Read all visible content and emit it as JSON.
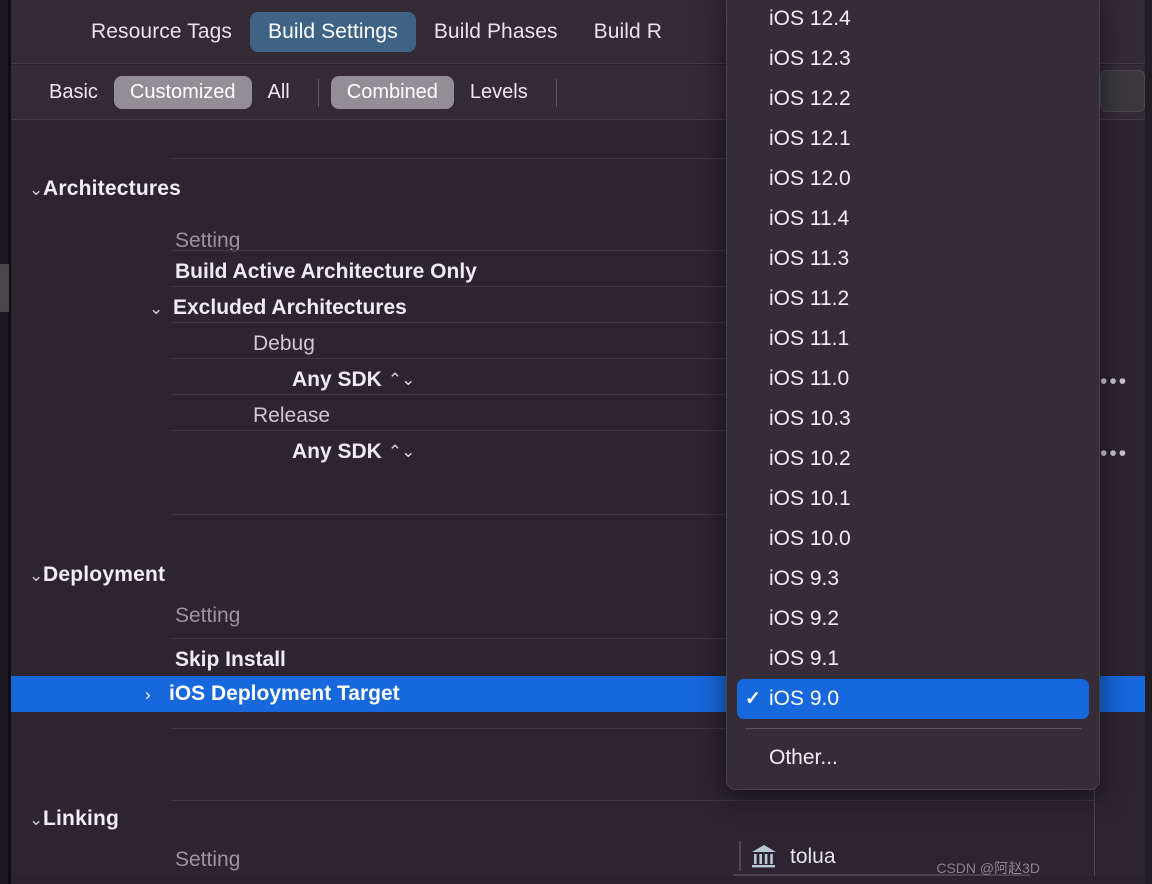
{
  "window": {
    "background_color": "#2a222c",
    "accent_blue": "#1668dc",
    "tab_active_color": "#3f6384"
  },
  "tabbar": {
    "tabs": [
      {
        "label": "Resource Tags",
        "active": false
      },
      {
        "label": "Build Settings",
        "active": true
      },
      {
        "label": "Build Phases",
        "active": false
      },
      {
        "label": "Build R",
        "active": false
      }
    ]
  },
  "filterbar": {
    "segments": [
      {
        "label": "Basic",
        "on": false
      },
      {
        "label": "Customized",
        "on": true
      },
      {
        "label": "All",
        "on": false
      },
      {
        "label": "Combined",
        "on": true
      },
      {
        "label": "Levels",
        "on": false
      }
    ],
    "search_placeholder": ""
  },
  "settings": {
    "column_header": "Setting",
    "groups": [
      {
        "title": "Architectures",
        "expanded": true,
        "rows": [
          {
            "kind": "header",
            "label": "Setting"
          },
          {
            "kind": "setting",
            "label": "Build Active Architecture Only",
            "indent": 1,
            "disclosure": false
          },
          {
            "kind": "setting",
            "label": "Excluded Architectures",
            "indent": 1,
            "disclosure": true,
            "disclosure_state": "expanded"
          },
          {
            "kind": "sub",
            "label": "Debug",
            "indent": 2
          },
          {
            "kind": "value",
            "label": "Any SDK",
            "indent": 3,
            "stepper": true,
            "more": true
          },
          {
            "kind": "sub",
            "label": "Release",
            "indent": 2
          },
          {
            "kind": "value",
            "label": "Any SDK",
            "indent": 3,
            "stepper": true,
            "more": true
          }
        ]
      },
      {
        "title": "Deployment",
        "expanded": true,
        "rows": [
          {
            "kind": "header",
            "label": "Setting"
          },
          {
            "kind": "setting",
            "label": "Skip Install",
            "indent": 1,
            "disclosure": false
          },
          {
            "kind": "setting",
            "label": "iOS Deployment Target",
            "indent": 1,
            "disclosure": true,
            "disclosure_state": "collapsed",
            "selected": true
          }
        ]
      },
      {
        "title": "Linking",
        "expanded": true,
        "rows": [
          {
            "kind": "header",
            "label": "Setting"
          }
        ]
      }
    ],
    "more_label": "•••"
  },
  "library_row": {
    "icon": "library-building-icon",
    "name": "tolua"
  },
  "dropdown": {
    "items": [
      {
        "label": "iOS 12.4",
        "selected": false
      },
      {
        "label": "iOS 12.3",
        "selected": false
      },
      {
        "label": "iOS 12.2",
        "selected": false
      },
      {
        "label": "iOS 12.1",
        "selected": false
      },
      {
        "label": "iOS 12.0",
        "selected": false
      },
      {
        "label": "iOS 11.4",
        "selected": false
      },
      {
        "label": "iOS 11.3",
        "selected": false
      },
      {
        "label": "iOS 11.2",
        "selected": false
      },
      {
        "label": "iOS 11.1",
        "selected": false
      },
      {
        "label": "iOS 11.0",
        "selected": false
      },
      {
        "label": "iOS 10.3",
        "selected": false
      },
      {
        "label": "iOS 10.2",
        "selected": false
      },
      {
        "label": "iOS 10.1",
        "selected": false
      },
      {
        "label": "iOS 10.0",
        "selected": false
      },
      {
        "label": "iOS 9.3",
        "selected": false
      },
      {
        "label": "iOS 9.2",
        "selected": false
      },
      {
        "label": "iOS 9.1",
        "selected": false
      },
      {
        "label": "iOS 9.0",
        "selected": true
      }
    ],
    "checkmark": "✓",
    "other_label": "Other..."
  },
  "watermark": {
    "text": "CSDN @阿赵3D"
  }
}
